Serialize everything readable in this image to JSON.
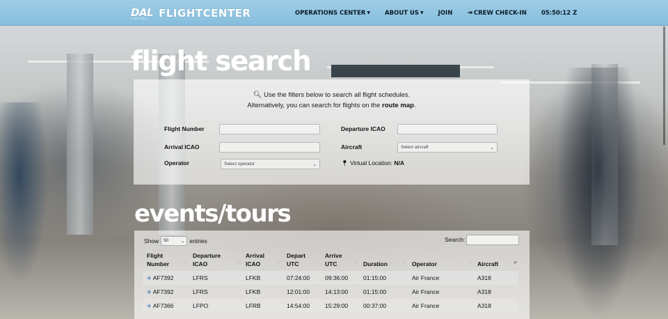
{
  "navbar": {
    "logo_text": "DAL",
    "logo_sub": "VIRTUAL",
    "brand": "FLIGHTCENTER",
    "items": [
      {
        "label": "OPERATIONS CENTER",
        "dropdown": true
      },
      {
        "label": "ABOUT US",
        "dropdown": true
      },
      {
        "label": "JOIN",
        "dropdown": false
      },
      {
        "label": "CREW CHECK-IN",
        "dropdown": false,
        "icon": "sign-in-icon"
      }
    ],
    "clock": "05:50:12 Z"
  },
  "search": {
    "heading": "flight search",
    "hint_line1": "Use the filters below to search all flight schedules.",
    "hint_line2_prefix": "Alternatively, you can search for flights on the",
    "route_map_link": "route map",
    "hint_line2_suffix": ".",
    "fields": {
      "flight_number_label": "Flight Number",
      "arrival_icao_label": "Arrival ICAO",
      "operator_label": "Operator",
      "operator_placeholder": "Select operator",
      "departure_icao_label": "Departure ICAO",
      "aircraft_label": "Aircraft",
      "aircraft_placeholder": "Select aircraft"
    },
    "virtual_location_label": "Virtual Location:",
    "virtual_location_value": "N/A"
  },
  "events": {
    "heading": "events/tours"
  },
  "table": {
    "show_label": "Show",
    "entries_value": "50",
    "entries_label": "entries",
    "search_label": "Search:",
    "headers": [
      {
        "line1": "Flight",
        "line2": "Number"
      },
      {
        "line1": "Departure",
        "line2": "ICAO"
      },
      {
        "line1": "Arrival",
        "line2": "ICAO"
      },
      {
        "line1": "Depart",
        "line2": "UTC"
      },
      {
        "line1": "Arrive",
        "line2": "UTC"
      },
      {
        "line1": "Duration",
        "line2": ""
      },
      {
        "line1": "Operator",
        "line2": ""
      },
      {
        "line1": "Aircraft",
        "line2": ""
      }
    ],
    "rows": [
      {
        "flight": "AF7392",
        "dep": "LFRS",
        "arr": "LFKB",
        "depart": "07:24:00",
        "arrive": "09:36:00",
        "duration": "01:15:00",
        "operator": "Air France",
        "aircraft": "A318"
      },
      {
        "flight": "AF7392",
        "dep": "LFRS",
        "arr": "LFKB",
        "depart": "12:01:00",
        "arrive": "14:13:00",
        "duration": "01:15:00",
        "operator": "Air France",
        "aircraft": "A318"
      },
      {
        "flight": "AF7366",
        "dep": "LFPO",
        "arr": "LFRB",
        "depart": "14:54:00",
        "arrive": "15:29:00",
        "duration": "00:37:00",
        "operator": "Air France",
        "aircraft": "A318"
      }
    ]
  },
  "colors": {
    "navbar": "#9fcde6",
    "nav_text": "#0a1a2a",
    "heading": "#ffffff",
    "plane_icon": "#2b6cb0"
  }
}
